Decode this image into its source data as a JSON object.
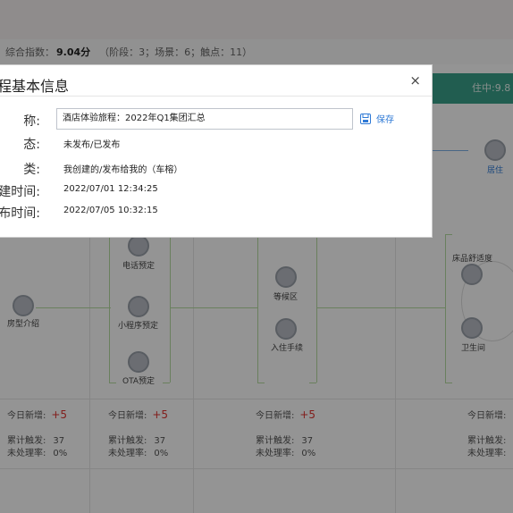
{
  "summary": {
    "label": "综合指数：",
    "score": "9.04分",
    "meta": "（阶段：3；场景：6；触点：11）"
  },
  "stage_bar": {
    "label": "住中:9.8"
  },
  "nodes": [
    {
      "label": "居住"
    },
    {
      "label": "电话预定"
    },
    {
      "label": "小程序预定"
    },
    {
      "label": "OTA预定"
    },
    {
      "label": "房型介绍"
    },
    {
      "label": "等候区"
    },
    {
      "label": "入住手续"
    },
    {
      "label": "床品舒适度"
    },
    {
      "label": "卫生间"
    }
  ],
  "stats_labels": {
    "new_today": "今日新增:",
    "plus": "+5",
    "total": "累计触发:",
    "total_value": "37",
    "unprocessed": "未处理率:",
    "unprocessed_value": "0%"
  },
  "modal": {
    "title": "程基本信息",
    "close": "×",
    "fields": {
      "name": {
        "label": "称:",
        "value": "酒店体验旅程：2022年Q1集团汇总"
      },
      "status": {
        "label": "态:",
        "value": "未发布/已发布"
      },
      "type": {
        "label": "类:",
        "value": "我创建的/发布给我的（车榕）"
      },
      "created": {
        "label": "建时间:",
        "value": "2022/07/01  12:34:25"
      },
      "published": {
        "label": "布时间:",
        "value": "2022/07/05  10:32:15"
      }
    },
    "save_label": "保存"
  }
}
